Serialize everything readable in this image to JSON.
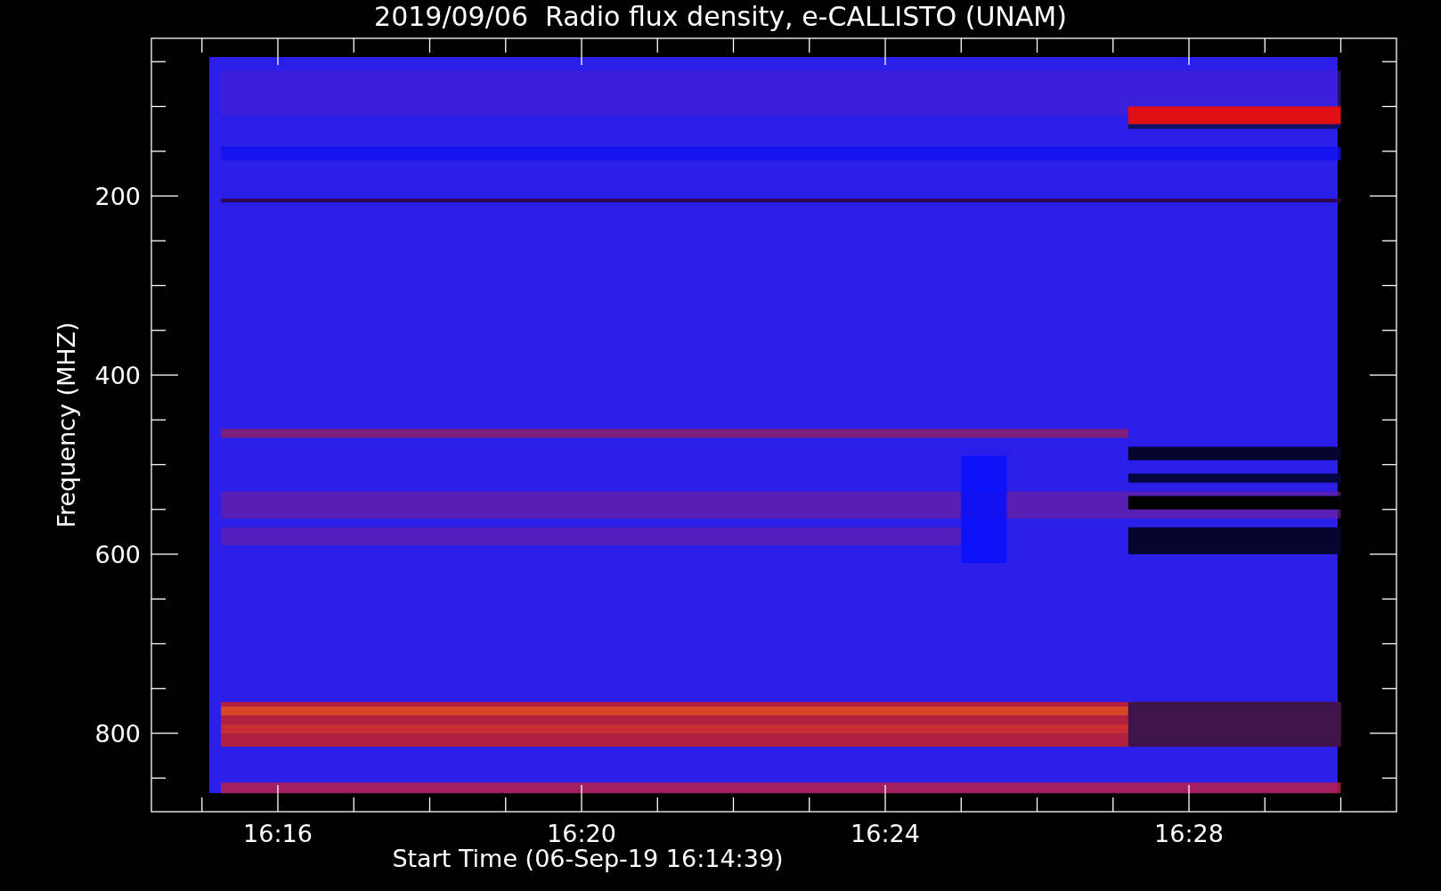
{
  "title": "2019/09/06  Radio flux density, e-CALLISTO (UNAM)",
  "y_axis": {
    "label": "Frequency (MHZ)",
    "ticks": [
      "200",
      "400",
      "600",
      "800"
    ]
  },
  "x_axis": {
    "label": "Start Time (06-Sep-19 16:14:39)",
    "ticks": [
      "16:16",
      "16:20",
      "16:24",
      "16:28"
    ]
  }
}
